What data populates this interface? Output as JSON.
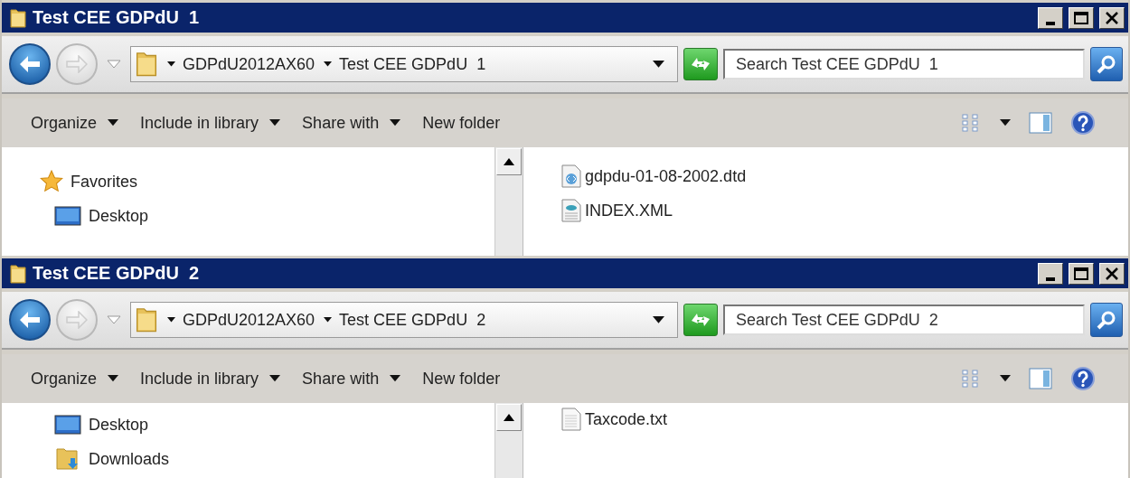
{
  "windows": [
    {
      "title": "Test CEE GDPdU  1",
      "breadcrumb": [
        "GDPdU2012AX60",
        "Test CEE GDPdU  1"
      ],
      "search": {
        "placeholder": "Search Test CEE GDPdU  1"
      },
      "toolbar": [
        {
          "label": "Organize",
          "dropdown": true
        },
        {
          "label": "Include in library",
          "dropdown": true
        },
        {
          "label": "Share with",
          "dropdown": true
        },
        {
          "label": "New folder",
          "dropdown": false
        }
      ],
      "sidebar": {
        "items": [
          {
            "kind": "favorites",
            "label": "Favorites"
          },
          {
            "kind": "desktop",
            "label": "Desktop"
          }
        ]
      },
      "files": [
        {
          "kind": "dtd",
          "name": "gdpdu-01-08-2002.dtd"
        },
        {
          "kind": "xml",
          "name": "INDEX.XML"
        }
      ]
    },
    {
      "title": "Test CEE GDPdU  2",
      "breadcrumb": [
        "GDPdU2012AX60",
        "Test CEE GDPdU  2"
      ],
      "search": {
        "placeholder": "Search Test CEE GDPdU  2"
      },
      "toolbar": [
        {
          "label": "Organize",
          "dropdown": true
        },
        {
          "label": "Include in library",
          "dropdown": true
        },
        {
          "label": "Share with",
          "dropdown": true
        },
        {
          "label": "New folder",
          "dropdown": false
        }
      ],
      "sidebar": {
        "items": [
          {
            "kind": "desktop",
            "label": "Desktop"
          },
          {
            "kind": "downloads",
            "label": "Downloads"
          }
        ]
      },
      "files": [
        {
          "kind": "txt",
          "name": "Taxcode.txt"
        }
      ]
    }
  ]
}
